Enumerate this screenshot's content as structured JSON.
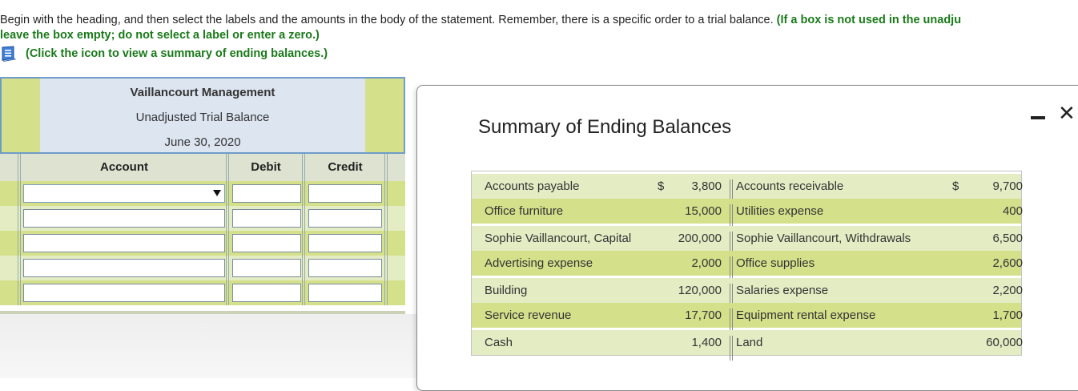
{
  "instructions": {
    "line1_plain": "Begin with the heading, and then select the labels and the amounts in the body of the statement. Remember, there is a specific order to a trial balance.",
    "line1_green": "(If a box is not used in the unadju",
    "line2": "leave the box empty; do not select a label or enter a zero.)",
    "summary_link": "(Click the icon to view a summary of ending balances.)",
    "summary_icon": "book-icon"
  },
  "trial_balance": {
    "company": "Vaillancourt Management",
    "title": "Unadjusted Trial Balance",
    "date": "June 30, 2020",
    "columns": {
      "account": "Account",
      "debit": "Debit",
      "credit": "Credit"
    }
  },
  "modal": {
    "title": "Summary of Ending Balances",
    "minimize_icon": "minimize-icon",
    "close_icon": "close-icon",
    "rows": [
      {
        "name1": "Accounts payable",
        "dollar1": "$",
        "value1": "3,800",
        "name2": "Accounts receivable",
        "dollar2": "$",
        "value2": "9,700"
      },
      {
        "name1": "Office furniture",
        "dollar1": "",
        "value1": "15,000",
        "name2": "Utilities expense",
        "dollar2": "",
        "value2": "400"
      },
      {
        "name1": "Sophie Vaillancourt, Capital",
        "dollar1": "",
        "value1": "200,000",
        "name2": "Sophie Vaillancourt, Withdrawals",
        "dollar2": "",
        "value2": "6,500"
      },
      {
        "name1": "Advertising expense",
        "dollar1": "",
        "value1": "2,000",
        "name2": "Office supplies",
        "dollar2": "",
        "value2": "2,600"
      },
      {
        "name1": "Building",
        "dollar1": "",
        "value1": "120,000",
        "name2": "Salaries expense",
        "dollar2": "",
        "value2": "2,200"
      },
      {
        "name1": "Service revenue",
        "dollar1": "",
        "value1": "17,700",
        "name2": "Equipment rental expense",
        "dollar2": "",
        "value2": "1,700"
      },
      {
        "name1": "Cash",
        "dollar1": "",
        "value1": "1,400",
        "name2": "Land",
        "dollar2": "",
        "value2": "60,000"
      }
    ]
  },
  "colors": {
    "green_text": "#1a7a1a",
    "header_blue": "#dde5f1",
    "row_green_dark": "#d4e08a",
    "row_green_light": "#e4ecc4"
  }
}
